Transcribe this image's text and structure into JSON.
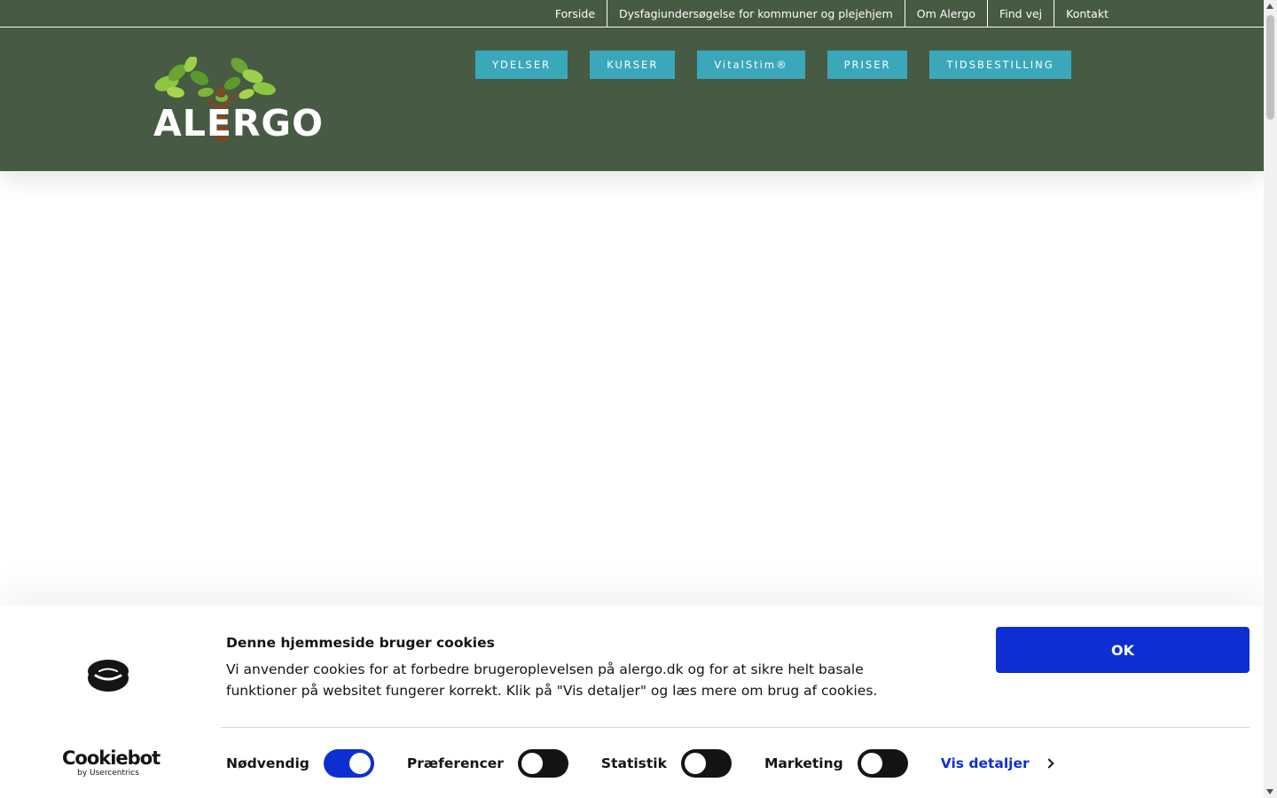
{
  "topnav": {
    "items": [
      {
        "label": "Forside"
      },
      {
        "label": "Dysfagiundersøgelse for kommuner og plejehjem"
      },
      {
        "label": "Om Alergo"
      },
      {
        "label": "Find vej"
      },
      {
        "label": "Kontakt"
      }
    ]
  },
  "logo": {
    "text": "ALERGO"
  },
  "mainnav": {
    "items": [
      {
        "label": "YDELSER"
      },
      {
        "label": "KURSER"
      },
      {
        "label": "VitalStim®"
      },
      {
        "label": "PRISER"
      },
      {
        "label": "TIDSBESTILLING"
      }
    ]
  },
  "cookie": {
    "title": "Denne hjemmeside bruger cookies",
    "text": "Vi anvender cookies for at forbedre brugeroplevelsen på alergo.dk og for at sikre helt basale funktioner på websitet fungerer korrekt. Klik på \"Vis detaljer\" og læs mere om brug af cookies.",
    "ok_label": "OK",
    "brand": "Cookiebot",
    "brand_sub": "by Usercentrics",
    "toggles": [
      {
        "label": "Nødvendig",
        "on": true
      },
      {
        "label": "Præferencer",
        "on": false
      },
      {
        "label": "Statistik",
        "on": false
      },
      {
        "label": "Marketing",
        "on": false
      }
    ],
    "details_label": "Vis detaljer"
  },
  "colors": {
    "header_bg": "#475a43",
    "nav_button": "#3aa8ba",
    "cookie_accent": "#0d2fd1"
  }
}
